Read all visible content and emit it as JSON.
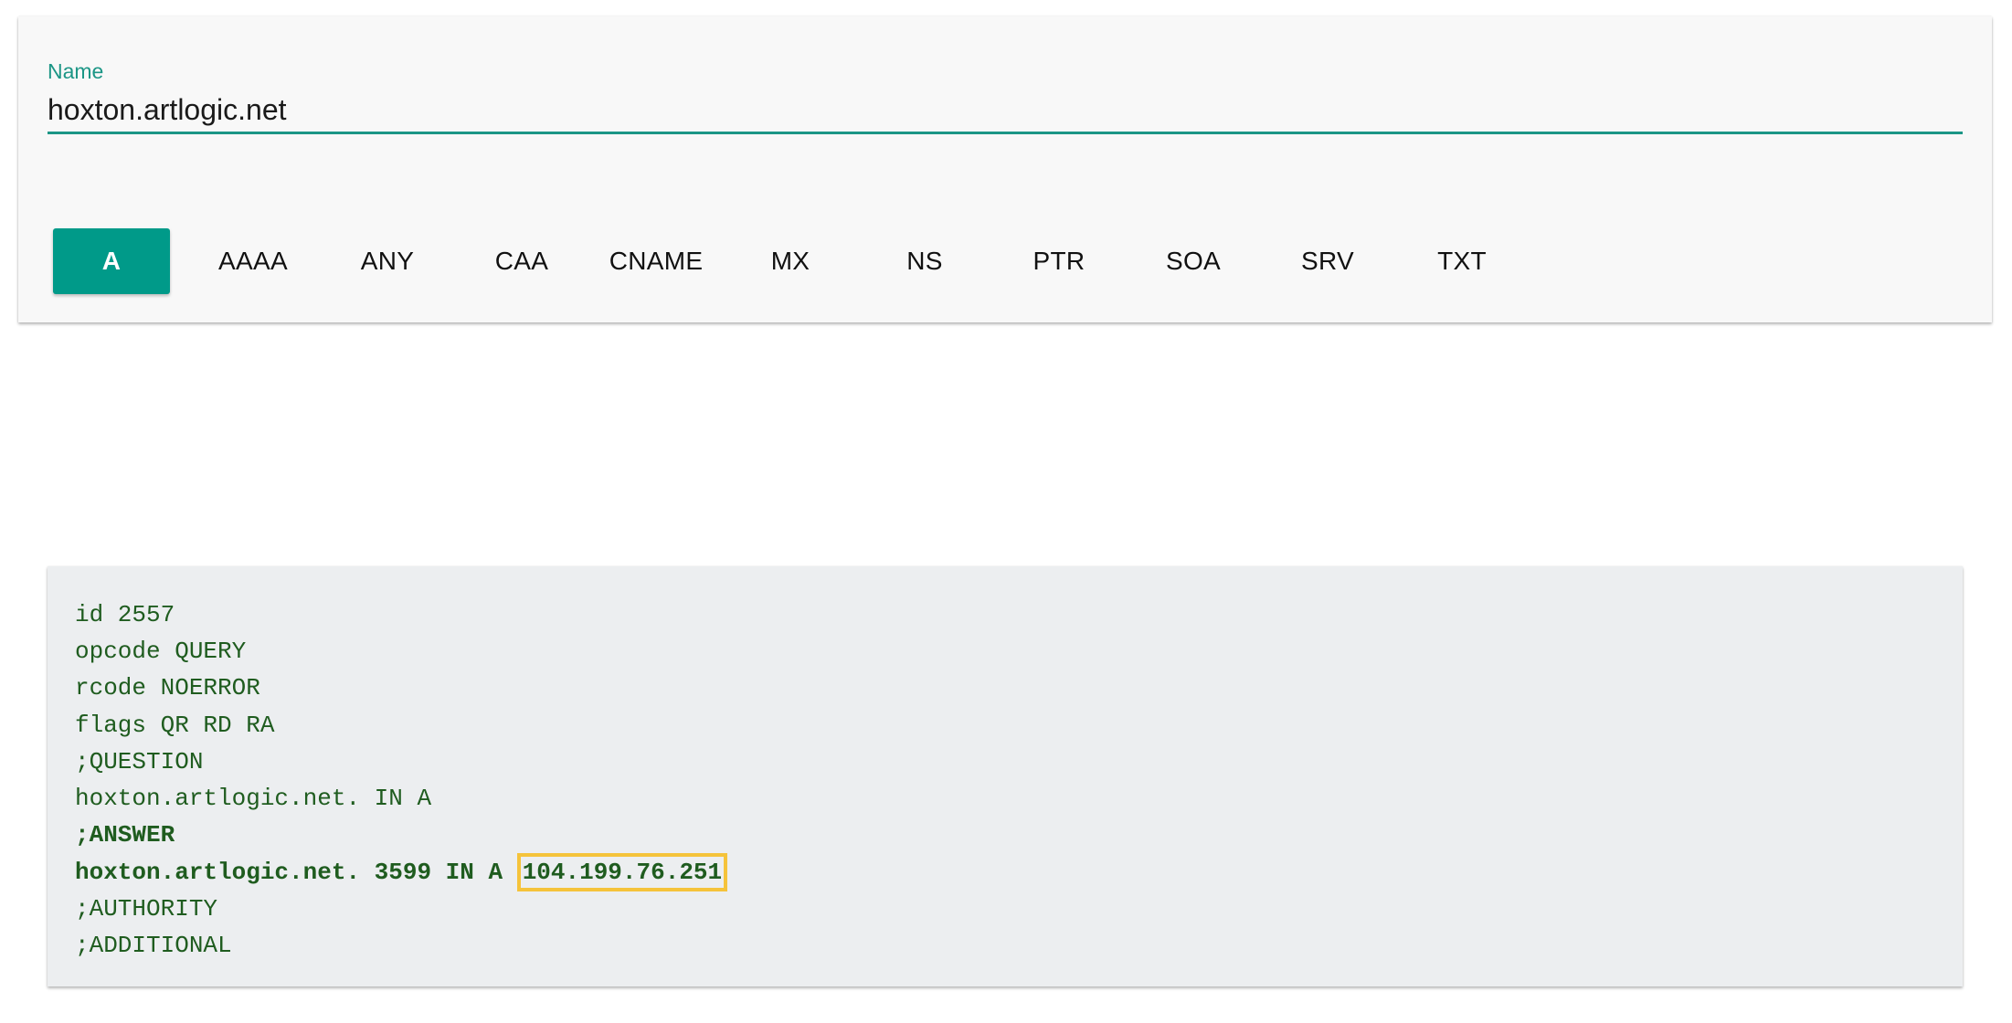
{
  "form": {
    "name_label": "Name",
    "name_value": "hoxton.artlogic.net"
  },
  "record_types": [
    "A",
    "AAAA",
    "ANY",
    "CAA",
    "CNAME",
    "MX",
    "NS",
    "PTR",
    "SOA",
    "SRV",
    "TXT"
  ],
  "selected_type": "A",
  "result": {
    "id_line": "id 2557",
    "opcode_line": "opcode QUERY",
    "rcode_line": "rcode NOERROR",
    "flags_line": "flags QR RD RA",
    "question_header": ";QUESTION",
    "question_line": "hoxton.artlogic.net. IN A",
    "answer_header": ";ANSWER",
    "answer_prefix": "hoxton.artlogic.net. 3599 IN A ",
    "answer_ip": "104.199.76.251",
    "authority_header": ";AUTHORITY",
    "additional_header": ";ADDITIONAL"
  },
  "colors": {
    "accent": "#009a89",
    "label": "#1c9686",
    "result_text": "#1f5c1f",
    "highlight_border": "#f5c33b",
    "result_bg": "#eceef0"
  }
}
